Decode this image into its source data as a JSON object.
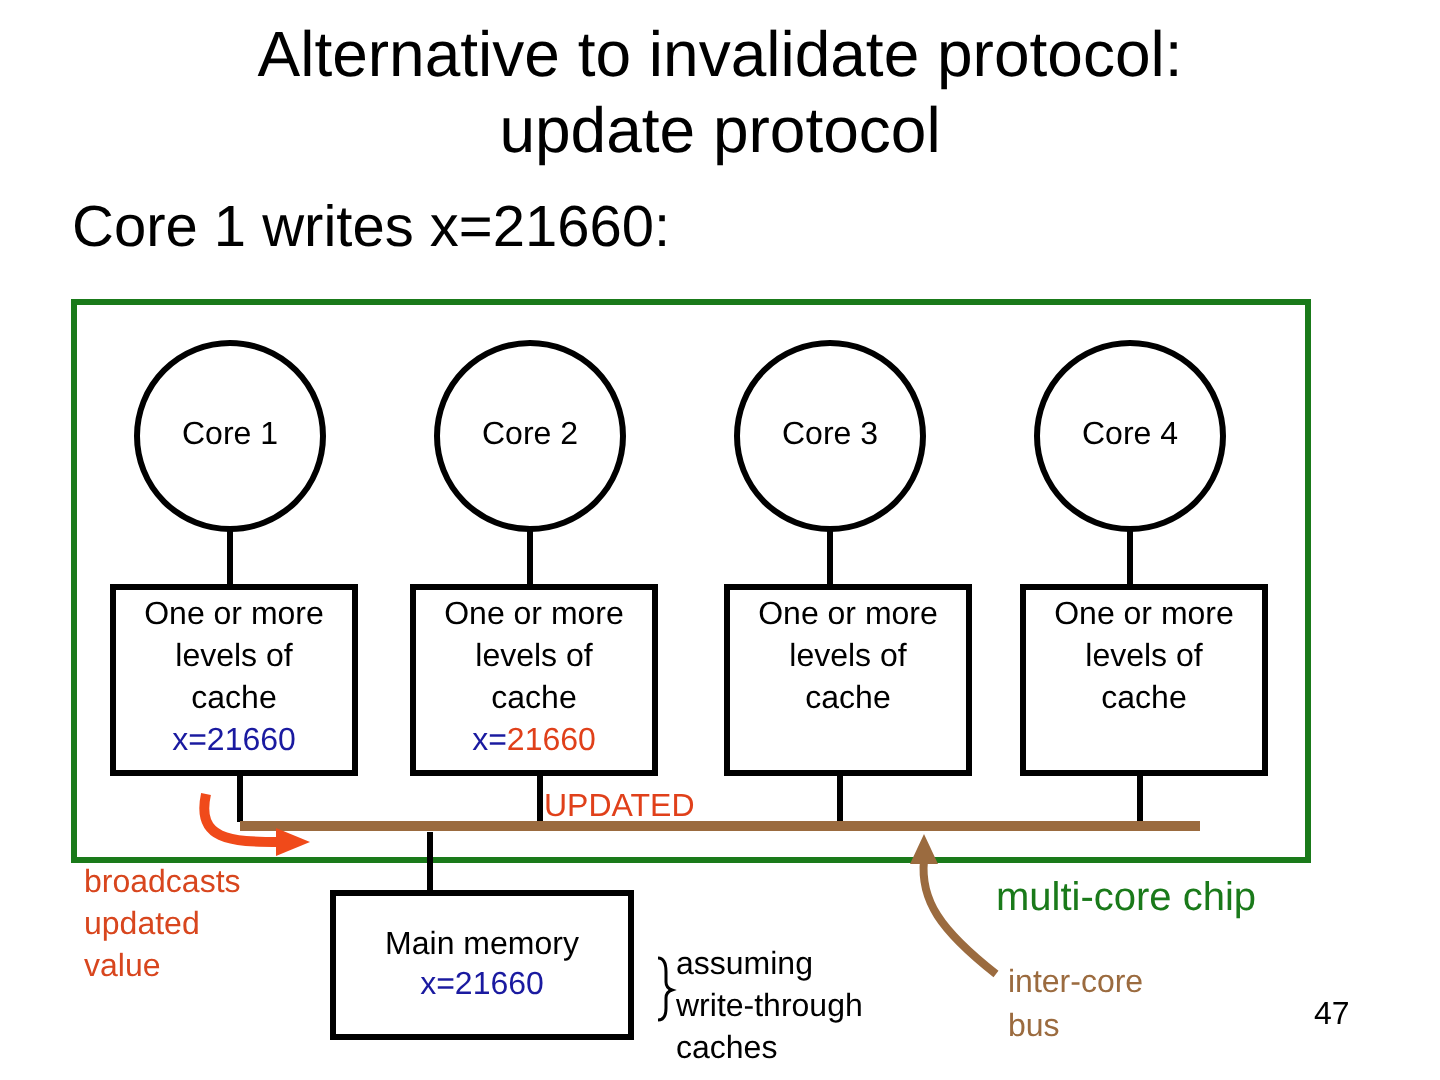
{
  "title": "Alternative to invalidate protocol: update protocol",
  "subtitle": "Core 1 writes x=21660:",
  "cores": [
    {
      "name": "Core 1",
      "cache": "One or more levels of cache",
      "value_label": "x=",
      "value": "21660",
      "updated": false
    },
    {
      "name": "Core 2",
      "cache": "One or more levels of cache",
      "value_label": "x=",
      "value": "21660",
      "updated": true
    },
    {
      "name": "Core 3",
      "cache": "One or more levels of cache"
    },
    {
      "name": "Core 4",
      "cache": "One or more levels of cache"
    }
  ],
  "bus_label": "UPDATED",
  "broadcast_note": "broadcasts updated value",
  "main_memory": {
    "name": "Main memory",
    "value": "x=21660"
  },
  "chip_label": "multi-core chip",
  "assumption_note": "assuming write-through caches",
  "bus_note": "inter-core bus",
  "page_number": "47"
}
